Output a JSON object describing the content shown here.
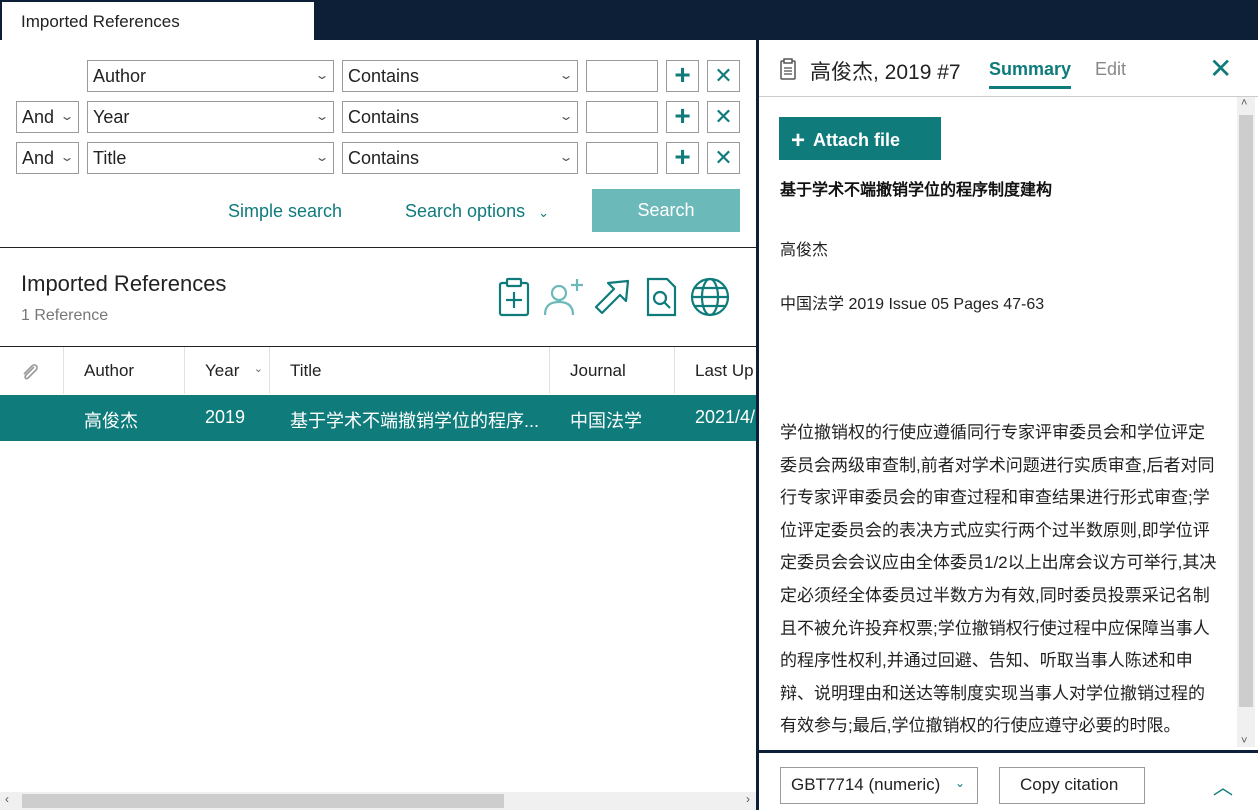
{
  "tab": {
    "label": "Imported References"
  },
  "search": {
    "rows": [
      {
        "connector": "",
        "field": "Author",
        "operator": "Contains",
        "value": ""
      },
      {
        "connector": "And",
        "field": "Year",
        "operator": "Contains",
        "value": ""
      },
      {
        "connector": "And",
        "field": "Title",
        "operator": "Contains",
        "value": ""
      }
    ],
    "simple_search": "Simple search",
    "search_options": "Search options",
    "search_button": "Search"
  },
  "references": {
    "title": "Imported References",
    "count": "1 Reference",
    "columns": [
      "Author",
      "Year",
      "Title",
      "Journal",
      "Last Up"
    ],
    "rows": [
      {
        "author": "高俊杰",
        "year": "2019",
        "title": "基于学术不端撤销学位的程序...",
        "journal": "中国法学",
        "last_updated": "2021/4/"
      }
    ]
  },
  "detail": {
    "title": "高俊杰, 2019 #7",
    "tabs": [
      "Summary",
      "Edit"
    ],
    "attach_label": "Attach file",
    "article_title": "基于学术不端撤销学位的程序制度建构",
    "author": "高俊杰",
    "journal_line": "中国法学 2019 Issue 05 Pages 47-63",
    "abstract": "学位撤销权的行使应遵循同行专家评审委员会和学位评定委员会两级审查制,前者对学术问题进行实质审查,后者对同行专家评审委员会的审查过程和审查结果进行形式审查;学位评定委员会的表决方式应实行两个过半数原则,即学位评定委员会会议应由全体委员1/2以上出席会议方可举行,其决定必须经全体委员过半数方为有效,同时委员投票采记名制且不被允许投弃权票;学位撤销权行使过程中应保障当事人的程序性权利,并通过回避、告知、听取当事人陈述和申辩、说明理由和送达等制度实现当事人对学位撤销过程的有效参与;最后,学位撤销权的行使应遵守必要的时限。"
  },
  "footer": {
    "style": "GBT7714 (numeric)",
    "copy_citation": "Copy citation"
  },
  "colors": {
    "accent": "#0f7b7b",
    "dark": "#0c1f36",
    "button_disabled": "#6cb9b9"
  }
}
